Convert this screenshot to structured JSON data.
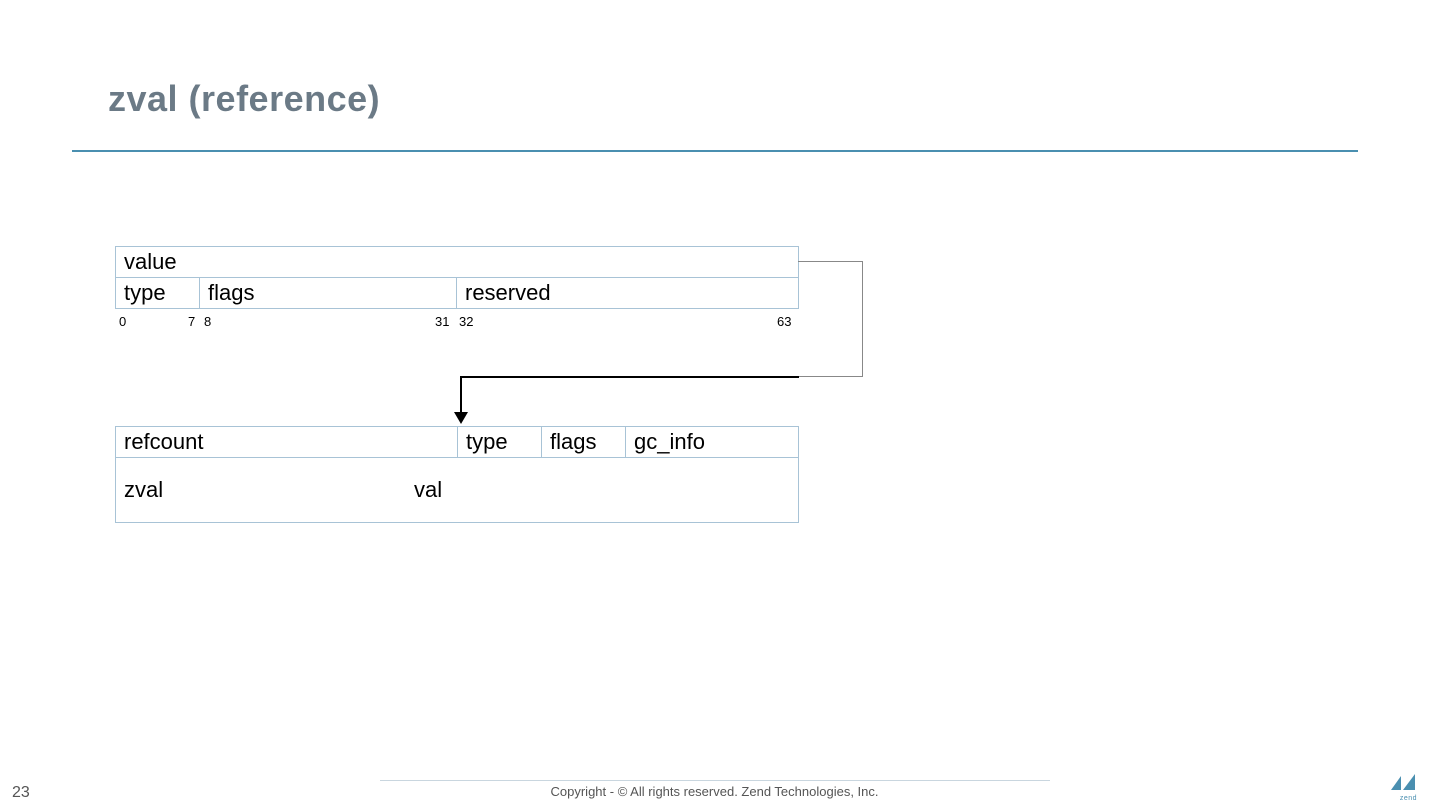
{
  "title": "zval (reference)",
  "upper_struct": {
    "row1": {
      "value": "value"
    },
    "row2": {
      "type": "type",
      "flags": "flags",
      "reserved": "reserved"
    },
    "bits": {
      "a0": "0",
      "a7": "7",
      "a8": "8",
      "a31": "31",
      "a32": "32",
      "a63": "63"
    }
  },
  "lower_struct": {
    "row1": {
      "refcount": "refcount",
      "type": "type",
      "flags": "flags",
      "gc_info": "gc_info"
    },
    "row2": {
      "zval": "zval",
      "val": "val"
    }
  },
  "footer": {
    "page": "23",
    "copyright": "Copyright - © All rights reserved. Zend Technologies, Inc.",
    "logo_text": "zend"
  }
}
